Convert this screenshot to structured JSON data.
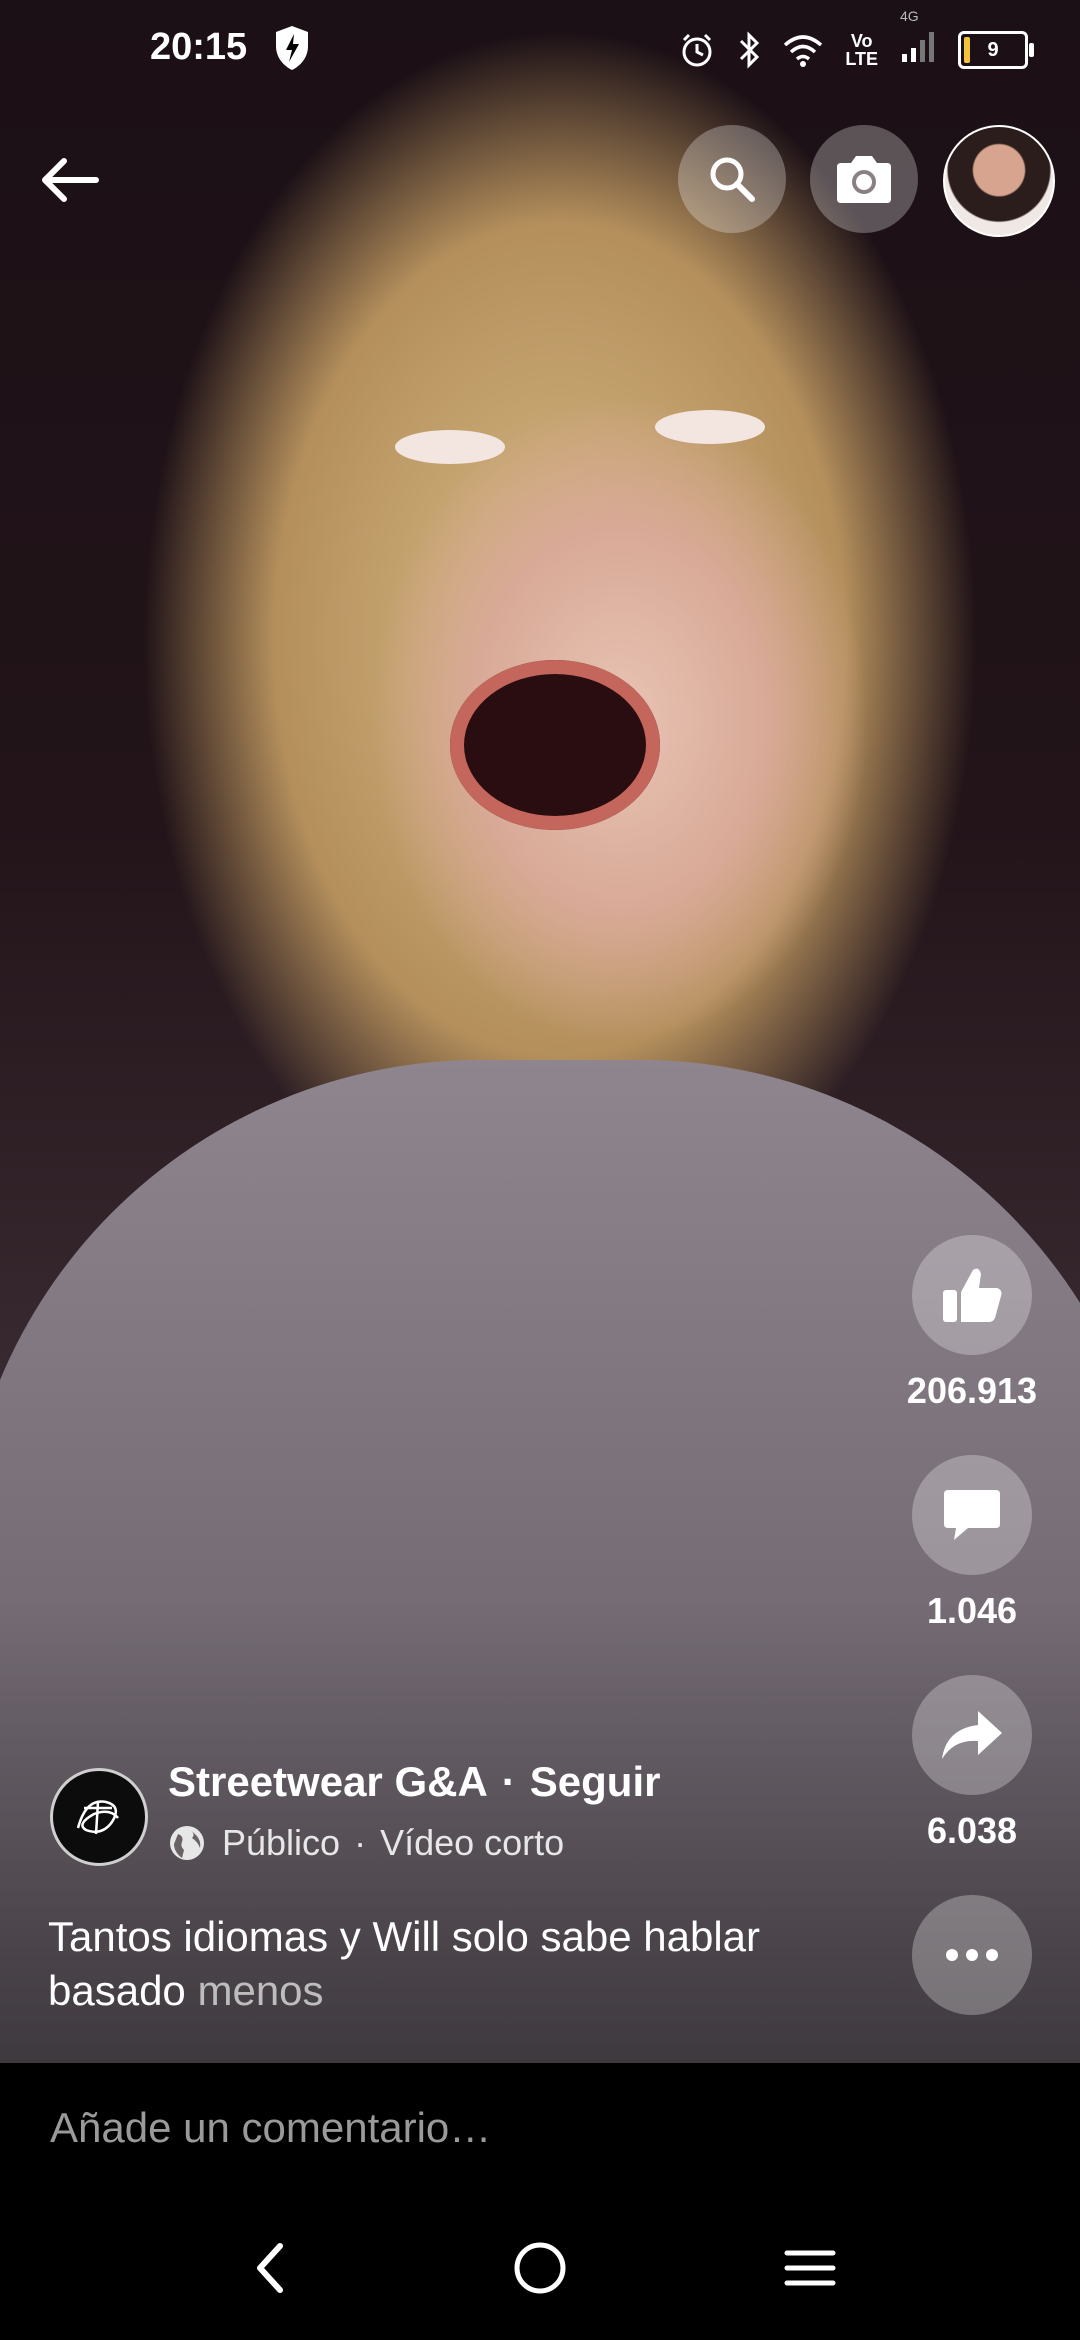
{
  "status_bar": {
    "time": "20:15",
    "volte": [
      "Vo",
      "LTE"
    ],
    "network": "4G",
    "battery": "9"
  },
  "icons": {
    "back": "arrow-left-icon",
    "search": "search-icon",
    "camera": "camera-icon",
    "like": "thumbs-up-icon",
    "comment": "comment-icon",
    "share": "share-icon",
    "more": "more-icon",
    "globe": "globe-icon"
  },
  "actions": {
    "likes": "206.913",
    "comments": "1.046",
    "shares": "6.038"
  },
  "post": {
    "author": "Streetwear G&A",
    "separator": "·",
    "follow": "Seguir",
    "privacy": "Público",
    "type": "Vídeo corto",
    "caption": "Tantos idiomas y Will solo sabe hablar basado",
    "less": "menos"
  },
  "comment": {
    "placeholder": "Añade un comentario…"
  },
  "colors": {
    "button_bg": "rgba(255,255,255,0.28)",
    "muted_text": "#bdbdbd",
    "battery_accent": "#f3c23c"
  }
}
